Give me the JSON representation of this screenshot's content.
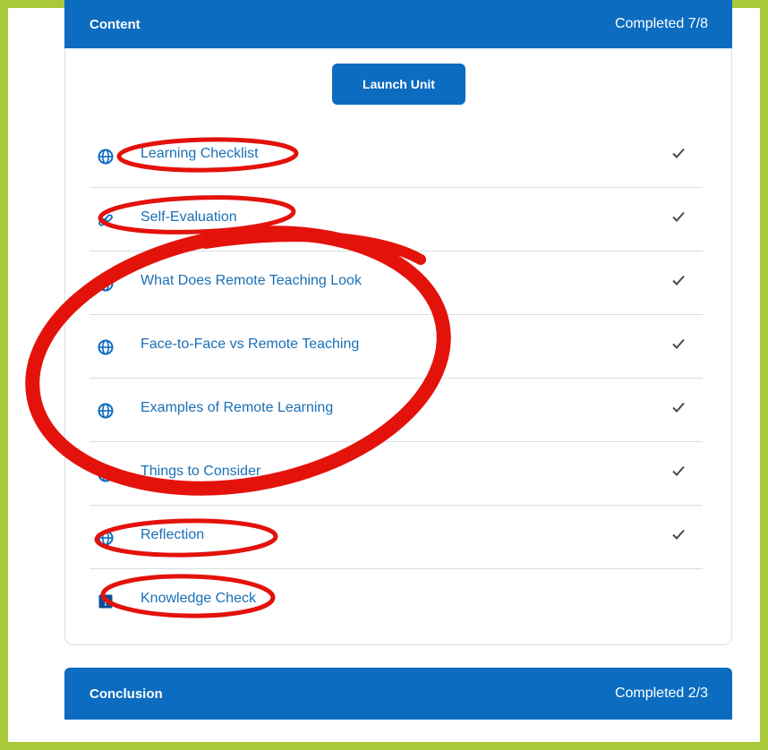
{
  "content": {
    "title": "Content",
    "status": "Completed 7/8",
    "launch_button": "Launch Unit",
    "items": [
      {
        "label": "Learning Checklist",
        "icon": "globe-icon",
        "completed": true
      },
      {
        "label": "Self-Evaluation",
        "icon": "link-icon",
        "completed": true
      },
      {
        "label": "What Does Remote Teaching Look",
        "icon": "globe-icon",
        "completed": true
      },
      {
        "label": "Face-to-Face vs Remote Teaching",
        "icon": "globe-icon",
        "completed": true
      },
      {
        "label": "Examples of Remote Learning",
        "icon": "globe-icon",
        "completed": true
      },
      {
        "label": "Things to Consider",
        "icon": "globe-icon",
        "completed": true
      },
      {
        "label": "Reflection",
        "icon": "globe-icon",
        "completed": true
      },
      {
        "label": "Knowledge Check",
        "icon": "quiz-icon",
        "completed": false
      }
    ]
  },
  "conclusion": {
    "title": "Conclusion",
    "status": "Completed 2/3"
  },
  "colors": {
    "frame": "#a9c93a",
    "header": "#0b6cc0",
    "link": "#1a6fb5",
    "annotation": "#e3120b"
  }
}
